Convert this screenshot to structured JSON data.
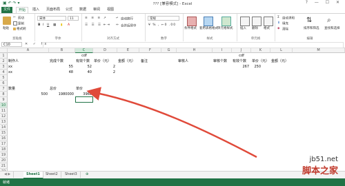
{
  "window": {
    "title": "???  [兼容模式] - Excel",
    "controls": "?  —  ☐  ✕"
  },
  "tabs": [
    "文件",
    "开始",
    "插入",
    "页面布局",
    "公式",
    "数据",
    "审阅",
    "视图"
  ],
  "ribbon": {
    "clipboard": {
      "cut": "剪切",
      "copy": "复制",
      "painter": "格式刷",
      "label": "剪贴板",
      "paste": "粘贴"
    },
    "font": {
      "name": "宋体",
      "size": "11",
      "label": "字体"
    },
    "alignment": {
      "wrap": "自动换行",
      "merge": "合并后居中",
      "label": "对齐方式"
    },
    "number": {
      "format": "常规",
      "label": "数字"
    },
    "styles": {
      "cond": "条件格式",
      "table": "套用表格格式",
      "cell": "单元格样式",
      "label": "样式"
    },
    "cells": {
      "insert": "插入",
      "delete": "删除",
      "format": "格式",
      "label": "单元格"
    },
    "editing": {
      "autosum": "自动求和",
      "fill": "填充",
      "clear": "清除",
      "sort": "排序和筛选",
      "find": "查找和选择",
      "label": "编辑"
    }
  },
  "formula_bar": {
    "name_box": "C10",
    "fx": "✕ ✓ fx",
    "value": ""
  },
  "columns": [
    "A",
    "B",
    "C",
    "D",
    "E",
    "F",
    "G",
    "H",
    "I",
    "J",
    "K",
    "L",
    "M"
  ],
  "rows": [
    "1",
    "2",
    "3",
    "4",
    "5",
    "6",
    "7",
    "8",
    "9",
    "10",
    "11",
    "12",
    "13",
    "14",
    "15",
    "16",
    "17",
    "18",
    "19",
    "20",
    "21",
    "22"
  ],
  "cells": {
    "c1_center": "cdf",
    "h1_center": "cdf",
    "a2": "制作人",
    "b2": "完成个数",
    "c2": "有效个数",
    "d2": "单价（元）",
    "e2": "金额（元）",
    "f2": "备注",
    "h2": "审核人",
    "i2": "审核个数",
    "j2": "有效个数",
    "k2": "单价（元）",
    "l2": "金额（元）",
    "a3": "xx",
    "c3": "55",
    "d3": "52",
    "e3": "2",
    "j3": "267",
    "k3": "250",
    "a4": "xx",
    "c4": "48",
    "d4": "40",
    "e4": "2",
    "a8": "数量",
    "b8": "总价",
    "c8": "单价",
    "a9": "500",
    "b9": "1980000",
    "c9": "3960"
  },
  "sheets": [
    "Sheet1",
    "Sheet2",
    "Sheet3"
  ],
  "status": {
    "ready": "就绪"
  },
  "watermark": {
    "line1": "jb51.net",
    "line2": "脚本之家"
  },
  "colors": {
    "accent": "#217346",
    "arrow": "#e04a3a"
  }
}
